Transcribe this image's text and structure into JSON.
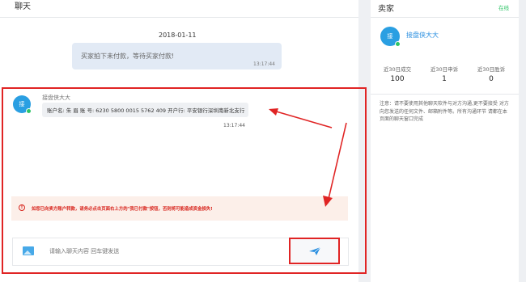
{
  "chat": {
    "title": "聊天",
    "date": "2018-01-11",
    "system_message": {
      "text": "买家拍下未付款，等待买家付款!",
      "time": "13:17:44"
    },
    "message": {
      "avatar_text": "接",
      "sender": "接盘侠大大",
      "text": "账户名: 朱 眉 账 号: 6230 5800 0015 5762 409 开户行: 平安银行深圳南新北支行",
      "time": "13:17:44"
    },
    "warning": "如您已向卖方账户转款，请务必点击页面右上方的\"我已付款\"按钮，否则将可能造成资金损失!",
    "input": {
      "placeholder": "请输入聊天内容 回车键发送"
    }
  },
  "seller": {
    "title": "卖家",
    "status": "在线",
    "avatar_text": "接",
    "name": "接盘侠大大",
    "stats": [
      {
        "label": "近30日成交",
        "value": "100"
      },
      {
        "label": "近30日申诉",
        "value": "1"
      },
      {
        "label": "近30日胜诉",
        "value": "0"
      }
    ],
    "notice": "注意：请不要使用其他聊天软件与对方沟通,更不要接受 对方向您发送的任何文件、邮箱附件等。所有沟通环节 请都在本页面的聊天窗口完成"
  },
  "colors": {
    "accent": "#2a9fe2",
    "annotation": "#e02424",
    "online": "#2ec467"
  },
  "icons": [
    "image-icon",
    "send-icon",
    "warning-icon"
  ]
}
